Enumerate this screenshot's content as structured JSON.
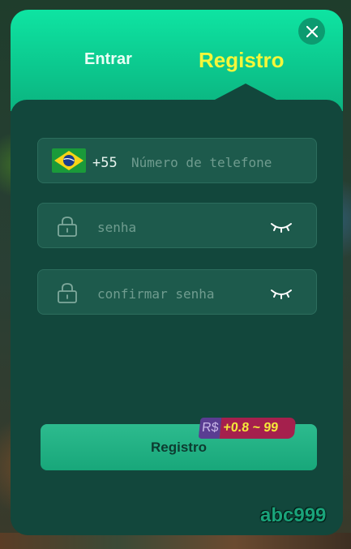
{
  "tabs": {
    "login_label": "Entrar",
    "register_label": "Registro",
    "active": "register"
  },
  "phone": {
    "country_flag": "brazil-flag",
    "dial_code": "+55",
    "placeholder": "Número de telefone",
    "value": ""
  },
  "password": {
    "placeholder": "senha",
    "value": ""
  },
  "confirm_password": {
    "placeholder": "confirmar senha",
    "value": ""
  },
  "submit": {
    "label": "Registro"
  },
  "bonus_badge": {
    "currency": "R$",
    "range": "+0.8 ~ 99"
  },
  "watermark": "abc999",
  "colors": {
    "header_gradient_top": "#0ee4a2",
    "header_gradient_bottom": "#0bb37f",
    "panel": "#12473c",
    "active_tab": "#f4f73a",
    "button": "#1faf82"
  }
}
